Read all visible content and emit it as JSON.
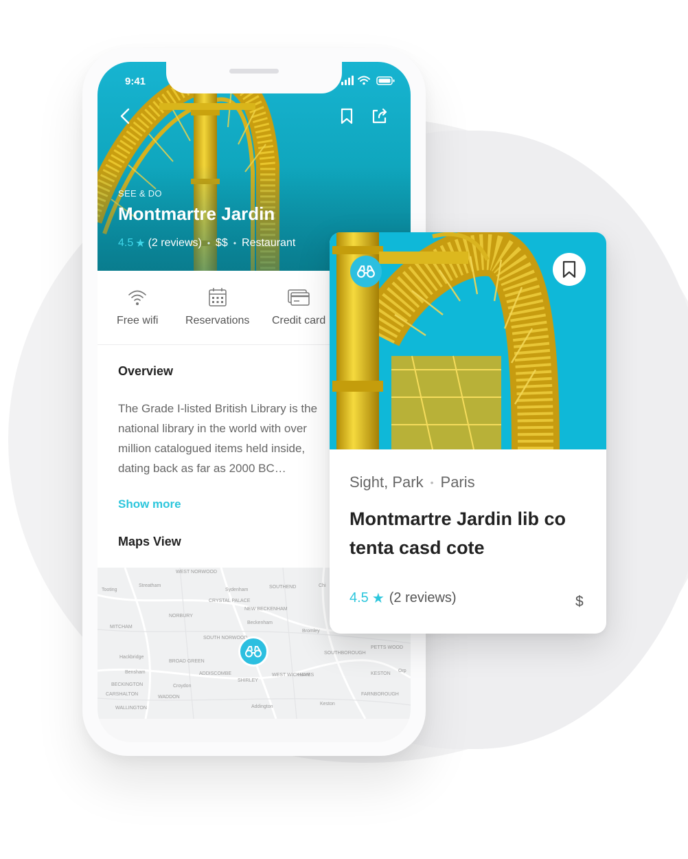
{
  "status": {
    "time": "9:41"
  },
  "place": {
    "category": "SEE & DO",
    "title": "Montmartre Jardin",
    "rating": "4.5",
    "reviews": "(2 reviews)",
    "price": "$$",
    "type": "Restaurant"
  },
  "amenities": [
    {
      "label": "Free wifi",
      "icon": "wifi-icon"
    },
    {
      "label": "Reservations",
      "icon": "calendar-icon"
    },
    {
      "label": "Credit card",
      "icon": "credit-card-icon"
    }
  ],
  "overview": {
    "heading": "Overview",
    "text": "The Grade I-listed British Library is the national library in the world with over million catalogued items held inside, dating back as far as 2000 BC…",
    "show_more": "Show more"
  },
  "maps": {
    "heading": "Maps View",
    "labels": [
      "WEST NORWOOD",
      "Tooting",
      "Streatham",
      "Sydenham",
      "SOUTHEND",
      "Chi",
      "CRYSTAL PALACE",
      "NEW BECKENHAM",
      "NORBURY",
      "Beckenham",
      "MITCHAM",
      "SOUTH NORWOOD",
      "Bromley",
      "PETTS WOOD",
      "Orp",
      "SOUTHBOROUGH",
      "Hackbridge",
      "BROAD GREEN",
      "Croydon",
      "ADDISCOMBE",
      "SHIRLEY",
      "WEST WICKHAM",
      "HAYES",
      "KESTON",
      "BECKINGTON",
      "CARSHALTON",
      "WADDON",
      "FARNBOROUGH",
      "WALLINGTON",
      "Addington",
      "Keston",
      "Bensham"
    ]
  },
  "card": {
    "category": "Sight, Park",
    "location": "Paris",
    "title": "Montmartre Jardin lib co tenta casd cote",
    "rating": "4.5",
    "reviews": "(2 reviews)",
    "price": "$"
  },
  "colors": {
    "accent": "#2cc6dc",
    "hero": "#0fa5bc",
    "coaster": "#e8c21a"
  }
}
